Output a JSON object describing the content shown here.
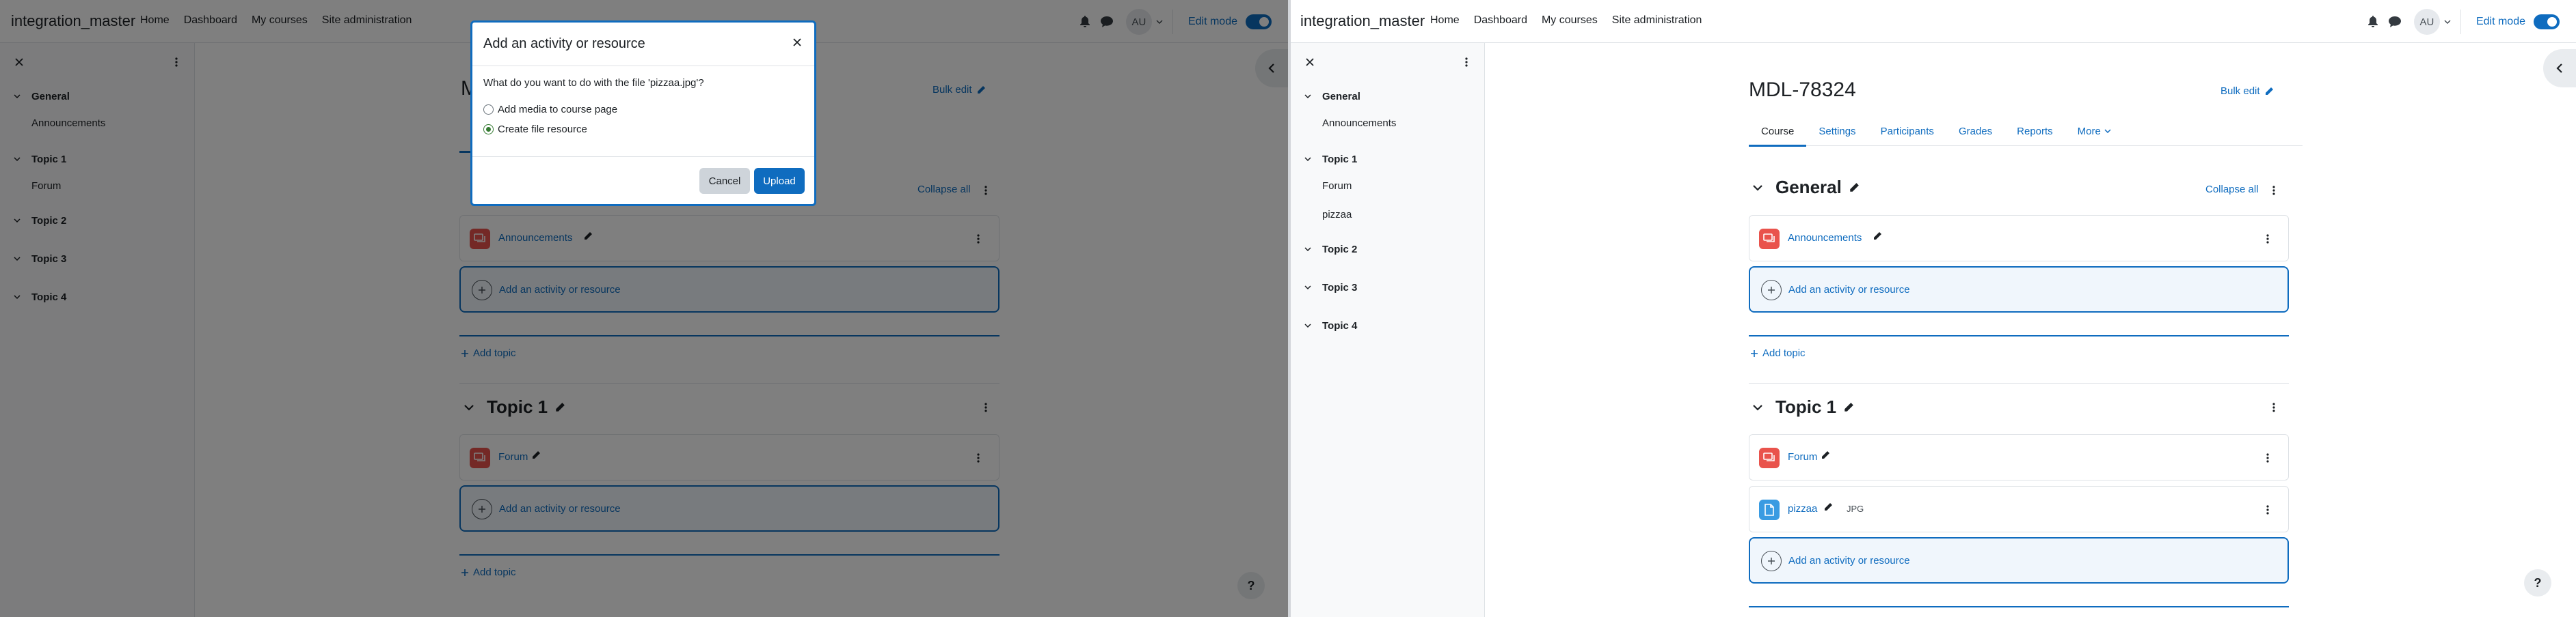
{
  "navbar": {
    "brand": "integration_master",
    "links": [
      "Home",
      "Dashboard",
      "My courses",
      "Site administration"
    ],
    "avatar_initials": "AU",
    "edit_mode_label": "Edit mode"
  },
  "left": {
    "course_index": {
      "sections": [
        {
          "title": "General",
          "items": [
            "Announcements"
          ]
        },
        {
          "title": "Topic 1",
          "items": [
            "Forum"
          ]
        },
        {
          "title": "Topic 2",
          "items": []
        },
        {
          "title": "Topic 3",
          "items": []
        },
        {
          "title": "Topic 4",
          "items": []
        }
      ]
    },
    "page_title_fragment": "M",
    "bulk_edit": "Bulk edit",
    "collapse_all": "Collapse all",
    "general": {
      "activities": [
        "Announcements"
      ]
    },
    "topic1": {
      "title": "Topic 1",
      "activities": [
        "Forum"
      ]
    },
    "add_activity": "Add an activity or resource",
    "add_topic": "Add topic",
    "modal": {
      "title": "Add an activity or resource",
      "prompt": "What do you want to do with the file 'pizzaa.jpg'?",
      "options": [
        "Add media to course page",
        "Create file resource"
      ],
      "selected_option": "Create file resource",
      "cancel": "Cancel",
      "upload": "Upload"
    }
  },
  "right": {
    "course_index": {
      "sections": [
        {
          "title": "General",
          "items": [
            "Announcements"
          ]
        },
        {
          "title": "Topic 1",
          "items": [
            "Forum",
            "pizzaa"
          ]
        },
        {
          "title": "Topic 2",
          "items": []
        },
        {
          "title": "Topic 3",
          "items": []
        },
        {
          "title": "Topic 4",
          "items": []
        }
      ]
    },
    "page_title": "MDL-78324",
    "bulk_edit": "Bulk edit",
    "tabs": [
      "Course",
      "Settings",
      "Participants",
      "Grades",
      "Reports",
      "More"
    ],
    "active_tab": "Course",
    "general": {
      "title": "General",
      "activities": [
        "Announcements"
      ]
    },
    "collapse_all": "Collapse all",
    "topic1": {
      "title": "Topic 1",
      "activities": [
        "Forum",
        "pizzaa"
      ],
      "file_badge": "JPG"
    },
    "add_activity": "Add an activity or resource",
    "add_topic": "Add topic"
  },
  "help_label": "?",
  "colors": {
    "primary": "#0f6cbf",
    "forum_icon": "#e9534c",
    "file_icon": "#399be2",
    "radio_checked": "#357a32"
  }
}
